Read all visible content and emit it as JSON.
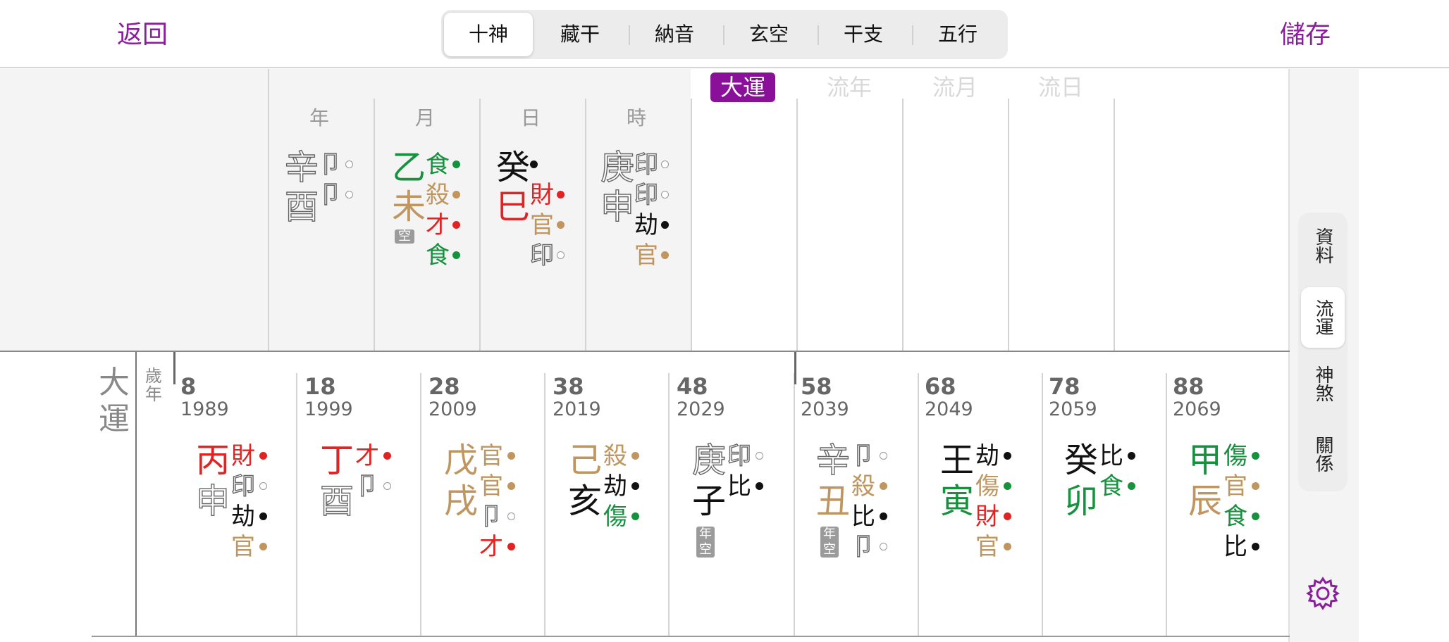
{
  "topbar": {
    "back": "返回",
    "save": "儲存",
    "tabs": [
      "十神",
      "藏干",
      "納音",
      "玄空",
      "干支",
      "五行"
    ],
    "active_tab": 0
  },
  "colors": {
    "purple": "#8a1f9c",
    "red": "#e02424",
    "green": "#16913e",
    "brown": "#c09660",
    "black": "#111111",
    "gray": "#777777"
  },
  "pillars": {
    "headers": [
      "年",
      "月",
      "日",
      "時"
    ],
    "luck_tabs": [
      "大運",
      "流年",
      "流月",
      "流日"
    ],
    "cols": [
      {
        "stem": "辛",
        "stem_color": "outline",
        "branch": "酉",
        "branch_color": "outline",
        "tags": [
          {
            "t": "卩",
            "c": "outline",
            "d": "hollow"
          },
          {
            "t": "卩",
            "c": "outline",
            "d": "hollow"
          }
        ],
        "badge": ""
      },
      {
        "stem": "乙",
        "stem_color": "green",
        "branch": "未",
        "branch_color": "brown",
        "tags": [
          {
            "t": "食",
            "c": "green",
            "d": "green"
          },
          {
            "t": "殺",
            "c": "brown",
            "d": "brown"
          },
          {
            "t": "才",
            "c": "red",
            "d": "red"
          },
          {
            "t": "食",
            "c": "green",
            "d": "green"
          }
        ],
        "badge": "空"
      },
      {
        "stem": "癸",
        "stem_color": "black",
        "branch": "巳",
        "branch_color": "red",
        "tags": [
          {
            "t": "",
            "c": "black",
            "d": "black"
          },
          {
            "t": "財",
            "c": "red",
            "d": "red"
          },
          {
            "t": "官",
            "c": "brown",
            "d": "brown"
          },
          {
            "t": "印",
            "c": "outline",
            "d": "hollow"
          }
        ],
        "badge": ""
      },
      {
        "stem": "庚",
        "stem_color": "outline",
        "branch": "申",
        "branch_color": "outline",
        "tags": [
          {
            "t": "印",
            "c": "outline",
            "d": "hollow"
          },
          {
            "t": "印",
            "c": "outline",
            "d": "hollow"
          },
          {
            "t": "劫",
            "c": "black",
            "d": "black"
          },
          {
            "t": "官",
            "c": "brown",
            "d": "brown"
          }
        ],
        "badge": ""
      }
    ]
  },
  "dayun": {
    "label": "大運",
    "suinian": "歲年",
    "cols": [
      {
        "age": "8",
        "year": "1989",
        "stem": "丙",
        "stem_color": "red",
        "branch": "申",
        "branch_color": "outline",
        "tags": [
          {
            "t": "財",
            "c": "red",
            "d": "red"
          },
          {
            "t": "印",
            "c": "outline",
            "d": "hollow"
          },
          {
            "t": "劫",
            "c": "black",
            "d": "black"
          },
          {
            "t": "官",
            "c": "brown",
            "d": "brown"
          }
        ],
        "badge": ""
      },
      {
        "age": "18",
        "year": "1999",
        "stem": "丁",
        "stem_color": "red",
        "branch": "酉",
        "branch_color": "outline",
        "tags": [
          {
            "t": "才",
            "c": "red",
            "d": "red"
          },
          {
            "t": "卩",
            "c": "outline",
            "d": "hollow"
          }
        ],
        "badge": ""
      },
      {
        "age": "28",
        "year": "2009",
        "stem": "戊",
        "stem_color": "brown",
        "branch": "戌",
        "branch_color": "brown",
        "tags": [
          {
            "t": "官",
            "c": "brown",
            "d": "brown"
          },
          {
            "t": "官",
            "c": "brown",
            "d": "brown"
          },
          {
            "t": "卩",
            "c": "outline",
            "d": "hollow"
          },
          {
            "t": "才",
            "c": "red",
            "d": "red"
          }
        ],
        "badge": ""
      },
      {
        "age": "38",
        "year": "2019",
        "stem": "己",
        "stem_color": "brown",
        "branch": "亥",
        "branch_color": "black",
        "tags": [
          {
            "t": "殺",
            "c": "brown",
            "d": "brown"
          },
          {
            "t": "劫",
            "c": "black",
            "d": "black"
          },
          {
            "t": "傷",
            "c": "green",
            "d": "green"
          }
        ],
        "badge": ""
      },
      {
        "age": "48",
        "year": "2029",
        "stem": "庚",
        "stem_color": "outline",
        "branch": "子",
        "branch_color": "black",
        "tags": [
          {
            "t": "印",
            "c": "outline",
            "d": "hollow"
          },
          {
            "t": "比",
            "c": "black",
            "d": "black"
          }
        ],
        "badge": "年空"
      },
      {
        "age": "58",
        "year": "2039",
        "stem": "辛",
        "stem_color": "outline",
        "branch": "丑",
        "branch_color": "brown",
        "tags": [
          {
            "t": "卩",
            "c": "outline",
            "d": "hollow"
          },
          {
            "t": "殺",
            "c": "brown",
            "d": "brown"
          },
          {
            "t": "比",
            "c": "black",
            "d": "black"
          },
          {
            "t": "卩",
            "c": "outline",
            "d": "hollow"
          }
        ],
        "badge": "年空"
      },
      {
        "age": "68",
        "year": "2049",
        "stem": "王",
        "stem_color": "black",
        "branch": "寅",
        "branch_color": "green",
        "tags": [
          {
            "t": "劫",
            "c": "black",
            "d": "black"
          },
          {
            "t": "傷",
            "c": "brown",
            "d": "green"
          },
          {
            "t": "財",
            "c": "red",
            "d": "red"
          },
          {
            "t": "官",
            "c": "brown",
            "d": "brown"
          }
        ],
        "badge": ""
      },
      {
        "age": "78",
        "year": "2059",
        "stem": "癸",
        "stem_color": "black",
        "branch": "卯",
        "branch_color": "green",
        "tags": [
          {
            "t": "比",
            "c": "black",
            "d": "black"
          },
          {
            "t": "食",
            "c": "green",
            "d": "green"
          }
        ],
        "badge": ""
      },
      {
        "age": "88",
        "year": "2069",
        "stem": "甲",
        "stem_color": "green",
        "branch": "辰",
        "branch_color": "brown",
        "tags": [
          {
            "t": "傷",
            "c": "green",
            "d": "green"
          },
          {
            "t": "官",
            "c": "brown",
            "d": "brown"
          },
          {
            "t": "食",
            "c": "green",
            "d": "green"
          },
          {
            "t": "比",
            "c": "black",
            "d": "black"
          }
        ],
        "badge": ""
      }
    ]
  },
  "side_menu": {
    "items": [
      "資料",
      "流運",
      "神煞",
      "關係"
    ],
    "active": 1
  },
  "icons": {
    "settings": "gear-icon"
  }
}
